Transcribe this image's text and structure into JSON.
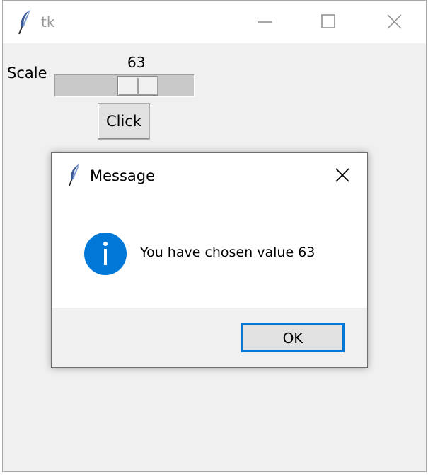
{
  "window": {
    "title": "tk",
    "icon": "feather-icon",
    "controls": [
      "minimize-icon",
      "maximize-icon",
      "close-icon"
    ]
  },
  "scale": {
    "label": "Scale",
    "value": "63"
  },
  "click_button": {
    "label": "Click"
  },
  "dialog": {
    "title": "Message",
    "icon": "feather-icon",
    "message_icon": "info-icon",
    "message": "You have chosen value 63",
    "ok_label": "OK"
  },
  "colors": {
    "window_bg": "#f0f0f0",
    "titlebar_bg": "#ffffff",
    "info_blue": "#0078d7",
    "focus_border": "#0078d7"
  }
}
